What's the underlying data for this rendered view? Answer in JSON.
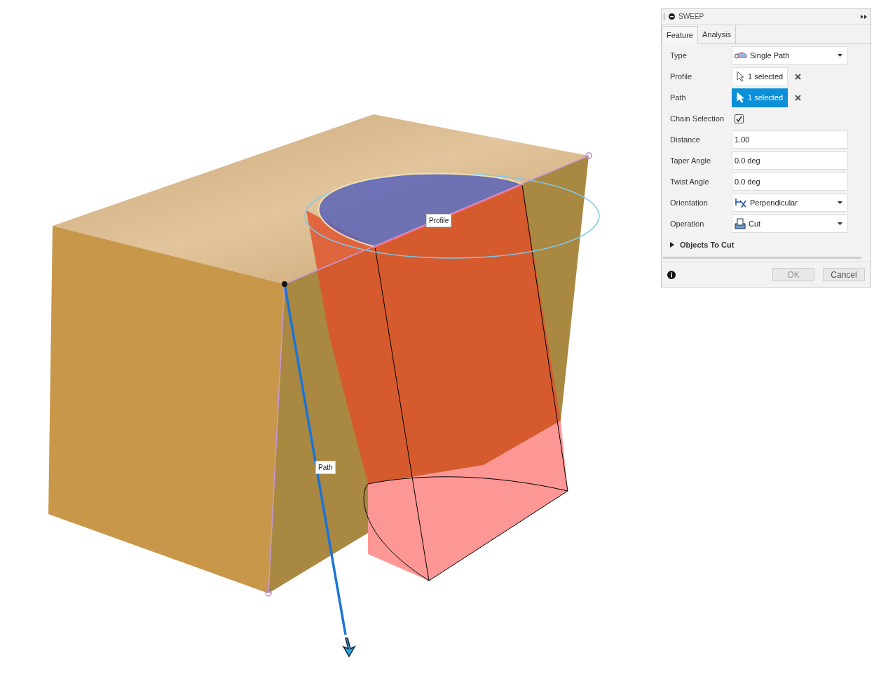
{
  "viewport": {
    "labels": [
      {
        "text": "Profile"
      },
      {
        "text": "Path"
      }
    ]
  },
  "panel": {
    "title": "SWEEP",
    "tabs": [
      {
        "label": "Feature",
        "selected": true
      },
      {
        "label": "Analysis",
        "selected": false
      }
    ],
    "rows": [
      {
        "kind": "dropdown",
        "label": "Type",
        "value": "Single Path"
      },
      {
        "kind": "selection",
        "label": "Profile",
        "value": "1 selected",
        "selected": false
      },
      {
        "kind": "selection",
        "label": "Path",
        "value": "1 selected",
        "selected": true
      },
      {
        "kind": "checkbox",
        "label": "Chain Selection",
        "checked": true
      },
      {
        "kind": "text",
        "label": "Distance",
        "value": "1.00"
      },
      {
        "kind": "text",
        "label": "Taper Angle",
        "value": "0.0 deg"
      },
      {
        "kind": "text",
        "label": "Twist Angle",
        "value": "0.0 deg"
      },
      {
        "kind": "dropdown",
        "label": "Orientation",
        "value": "Perpendicular"
      },
      {
        "kind": "dropdown",
        "label": "Operation",
        "value": "Cut"
      }
    ],
    "section": {
      "label": "Objects To Cut",
      "expanded": false
    },
    "buttons": [
      {
        "label": "OK",
        "disabled": true
      },
      {
        "label": "Cancel",
        "disabled": false
      }
    ]
  }
}
